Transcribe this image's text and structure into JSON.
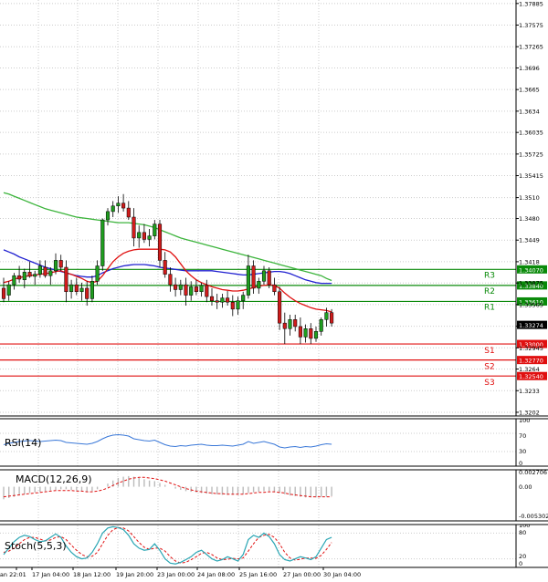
{
  "chart_data": {
    "type": "candlestick",
    "instrument_note": "",
    "price_axis": {
      "ticks": [
        1.37885,
        1.37575,
        1.37265,
        1.3696,
        1.3665,
        1.3634,
        1.36035,
        1.35725,
        1.35415,
        1.351,
        1.348,
        1.3449,
        1.3418,
        1.33875,
        1.33565,
        1.33255,
        1.32945,
        1.3264,
        1.3233,
        1.3202
      ],
      "range": [
        1.3198,
        1.37935
      ]
    },
    "time_axis": {
      "labels": [
        "Jan 22:01",
        "17 Jan 04:00",
        "18 Jan 12:00",
        "19 Jan 20:00",
        "23 Jan 00:00",
        "24 Jan 08:00",
        "25 Jan 16:00",
        "27 Jan 00:00",
        "30 Jan 04:00"
      ]
    },
    "current_price": "1.33274",
    "levels": [
      {
        "name": "R3",
        "value": 1.3407,
        "label": "1.34070",
        "color": "#0a8a0a"
      },
      {
        "name": "R2",
        "value": 1.3384,
        "label": "1.33840",
        "color": "#0a8a0a"
      },
      {
        "name": "R1",
        "value": 1.3361,
        "label": "1.33610",
        "color": "#0a8a0a"
      },
      {
        "name": "S1",
        "value": 1.33,
        "label": "1.33000",
        "color": "#e01010"
      },
      {
        "name": "S2",
        "value": 1.3277,
        "label": "1.32770",
        "color": "#e01010"
      },
      {
        "name": "S3",
        "value": 1.3254,
        "label": "1.32540",
        "color": "#e01010"
      }
    ],
    "candles": [
      [
        1.338,
        1.3395,
        1.336,
        1.3365
      ],
      [
        1.337,
        1.339,
        1.3362,
        1.3385
      ],
      [
        1.3385,
        1.3402,
        1.3378,
        1.3398
      ],
      [
        1.3398,
        1.3412,
        1.3388,
        1.3393
      ],
      [
        1.3392,
        1.3408,
        1.338,
        1.3403
      ],
      [
        1.3403,
        1.3418,
        1.3395,
        1.3397
      ],
      [
        1.3397,
        1.3405,
        1.3385,
        1.34
      ],
      [
        1.34,
        1.342,
        1.3395,
        1.3412
      ],
      [
        1.341,
        1.342,
        1.3395,
        1.3398
      ],
      [
        1.3398,
        1.341,
        1.3385,
        1.3405
      ],
      [
        1.3405,
        1.343,
        1.34,
        1.342
      ],
      [
        1.342,
        1.3428,
        1.3405,
        1.341
      ],
      [
        1.341,
        1.342,
        1.336,
        1.3375
      ],
      [
        1.3375,
        1.3392,
        1.3365,
        1.3385
      ],
      [
        1.3385,
        1.3395,
        1.337,
        1.3375
      ],
      [
        1.3375,
        1.3388,
        1.3362,
        1.338
      ],
      [
        1.338,
        1.339,
        1.3355,
        1.3365
      ],
      [
        1.3365,
        1.3398,
        1.336,
        1.339
      ],
      [
        1.339,
        1.342,
        1.3385,
        1.3412
      ],
      [
        1.3412,
        1.348,
        1.3405,
        1.3478
      ],
      [
        1.3478,
        1.3495,
        1.347,
        1.349
      ],
      [
        1.349,
        1.3505,
        1.3482,
        1.3498
      ],
      [
        1.3498,
        1.3512,
        1.3488,
        1.3502
      ],
      [
        1.3502,
        1.3515,
        1.349,
        1.3495
      ],
      [
        1.3495,
        1.3505,
        1.3478,
        1.3482
      ],
      [
        1.3482,
        1.3495,
        1.344,
        1.3452
      ],
      [
        1.3452,
        1.347,
        1.3438,
        1.346
      ],
      [
        1.346,
        1.3472,
        1.3445,
        1.345
      ],
      [
        1.345,
        1.3465,
        1.344,
        1.3455
      ],
      [
        1.3455,
        1.3478,
        1.345,
        1.3472
      ],
      [
        1.3472,
        1.3478,
        1.341,
        1.342
      ],
      [
        1.342,
        1.3432,
        1.3395,
        1.34
      ],
      [
        1.34,
        1.341,
        1.3375,
        1.3385
      ],
      [
        1.3385,
        1.3395,
        1.3368,
        1.3378
      ],
      [
        1.3378,
        1.3392,
        1.337,
        1.3385
      ],
      [
        1.3385,
        1.3395,
        1.3355,
        1.337
      ],
      [
        1.337,
        1.339,
        1.3362,
        1.3382
      ],
      [
        1.3382,
        1.3392,
        1.337,
        1.3375
      ],
      [
        1.3375,
        1.3388,
        1.3368,
        1.3384
      ],
      [
        1.3384,
        1.3392,
        1.336,
        1.3368
      ],
      [
        1.3368,
        1.338,
        1.3355,
        1.3362
      ],
      [
        1.3362,
        1.3372,
        1.335,
        1.336
      ],
      [
        1.336,
        1.3372,
        1.3352,
        1.3366
      ],
      [
        1.3366,
        1.3376,
        1.3355,
        1.336
      ],
      [
        1.336,
        1.337,
        1.334,
        1.335
      ],
      [
        1.335,
        1.3368,
        1.3342,
        1.3362
      ],
      [
        1.3362,
        1.3375,
        1.335,
        1.337
      ],
      [
        1.337,
        1.3428,
        1.3365,
        1.3412
      ],
      [
        1.3412,
        1.342,
        1.3372,
        1.338
      ],
      [
        1.338,
        1.3395,
        1.3372,
        1.339
      ],
      [
        1.339,
        1.3412,
        1.3385,
        1.3405
      ],
      [
        1.3405,
        1.341,
        1.338,
        1.3385
      ],
      [
        1.3385,
        1.3395,
        1.337,
        1.3375
      ],
      [
        1.3375,
        1.3382,
        1.332,
        1.333
      ],
      [
        1.333,
        1.3345,
        1.33,
        1.3322
      ],
      [
        1.3322,
        1.3342,
        1.3312,
        1.3335
      ],
      [
        1.3335,
        1.3342,
        1.3318,
        1.3325
      ],
      [
        1.3325,
        1.3338,
        1.33,
        1.331
      ],
      [
        1.331,
        1.3328,
        1.3302,
        1.3322
      ],
      [
        1.3322,
        1.333,
        1.33,
        1.3308
      ],
      [
        1.3308,
        1.3325,
        1.3303,
        1.3318
      ],
      [
        1.3318,
        1.3338,
        1.3312,
        1.3335
      ],
      [
        1.3335,
        1.3352,
        1.3325,
        1.3345
      ],
      [
        1.3345,
        1.335,
        1.3325,
        1.333
      ]
    ],
    "ma_fast": [
      1.3388,
      1.339,
      1.3393,
      1.3395,
      1.3397,
      1.3398,
      1.3399,
      1.34,
      1.3401,
      1.3402,
      1.3404,
      1.3405,
      1.3402,
      1.34,
      1.3397,
      1.3394,
      1.339,
      1.3388,
      1.339,
      1.3398,
      1.3408,
      1.3418,
      1.3425,
      1.343,
      1.3433,
      1.3435,
      1.3436,
      1.3436,
      1.3436,
      1.3436,
      1.3436,
      1.3435,
      1.3432,
      1.3425,
      1.3415,
      1.3405,
      1.3398,
      1.3392,
      1.3388,
      1.3385,
      1.3382,
      1.338,
      1.3378,
      1.3377,
      1.3376,
      1.3376,
      1.3377,
      1.3379,
      1.3381,
      1.3383,
      1.3384,
      1.3385,
      1.3384,
      1.338,
      1.3373,
      1.3367,
      1.3362,
      1.3358,
      1.3355,
      1.3352,
      1.335,
      1.3349,
      1.3348,
      1.3346
    ],
    "ma_mid": [
      1.3435,
      1.3432,
      1.3429,
      1.3425,
      1.3422,
      1.3419,
      1.3416,
      1.3413,
      1.341,
      1.3408,
      1.3406,
      1.3404,
      1.3402,
      1.34,
      1.3398,
      1.3397,
      1.3396,
      1.3396,
      1.3398,
      1.3402,
      1.3405,
      1.3408,
      1.341,
      1.3412,
      1.3413,
      1.3414,
      1.3414,
      1.3414,
      1.3413,
      1.3412,
      1.341,
      1.3409,
      1.3408,
      1.3407,
      1.3406,
      1.3405,
      1.3405,
      1.3405,
      1.3405,
      1.3405,
      1.3405,
      1.3404,
      1.3403,
      1.3402,
      1.3401,
      1.34,
      1.3399,
      1.3399,
      1.34,
      1.3401,
      1.3402,
      1.3403,
      1.3404,
      1.3404,
      1.3403,
      1.3401,
      1.3398,
      1.3395,
      1.3392,
      1.339,
      1.3388,
      1.3387,
      1.3387,
      1.3387
    ],
    "ma_slow": [
      1.3517,
      1.3515,
      1.3512,
      1.3509,
      1.3506,
      1.3503,
      1.35,
      1.3497,
      1.3494,
      1.3492,
      1.349,
      1.3488,
      1.3486,
      1.3484,
      1.3482,
      1.3481,
      1.348,
      1.3479,
      1.3478,
      1.3477,
      1.3476,
      1.3475,
      1.3474,
      1.3474,
      1.3474,
      1.3473,
      1.3472,
      1.3471,
      1.3469,
      1.3467,
      1.3464,
      1.3461,
      1.3458,
      1.3455,
      1.3452,
      1.345,
      1.3448,
      1.3446,
      1.3444,
      1.3442,
      1.344,
      1.3438,
      1.3436,
      1.3434,
      1.3432,
      1.343,
      1.3428,
      1.3426,
      1.3424,
      1.3422,
      1.342,
      1.3418,
      1.3416,
      1.3414,
      1.3412,
      1.341,
      1.3408,
      1.3406,
      1.3404,
      1.3402,
      1.34,
      1.3398,
      1.3394,
      1.3391
    ],
    "rsi": {
      "label": "RSI(14)",
      "ticks": [
        "100",
        "70",
        "30",
        "0"
      ],
      "range": [
        0,
        100
      ],
      "values": [
        45,
        48,
        50,
        52,
        53,
        54,
        53,
        52,
        53,
        54,
        55,
        54,
        50,
        49,
        48,
        47,
        46,
        48,
        52,
        58,
        63,
        66,
        67,
        66,
        64,
        58,
        56,
        54,
        53,
        55,
        50,
        45,
        42,
        41,
        43,
        42,
        44,
        45,
        46,
        44,
        43,
        43,
        44,
        43,
        42,
        44,
        46,
        52,
        48,
        50,
        52,
        49,
        46,
        40,
        38,
        40,
        41,
        39,
        41,
        40,
        42,
        45,
        47,
        46
      ]
    },
    "macd": {
      "label": "MACD(12,26,9)",
      "ticks": [
        "0.002706",
        "0.00",
        "-0.005302"
      ],
      "range": [
        -0.005302,
        0.002706
      ],
      "histogram": [
        -0.002,
        -0.0018,
        -0.0016,
        -0.0014,
        -0.0012,
        -0.001,
        -0.0009,
        -0.0008,
        -0.0007,
        -0.0006,
        -0.0005,
        -0.0004,
        -0.0004,
        -0.0005,
        -0.0006,
        -0.0007,
        -0.0008,
        -0.0007,
        -0.0004,
        0.0,
        0.0005,
        0.001,
        0.0014,
        0.0016,
        0.0017,
        0.0016,
        0.0014,
        0.0012,
        0.001,
        0.0009,
        0.0006,
        0.0003,
        0.0,
        -0.0003,
        -0.0005,
        -0.0007,
        -0.0008,
        -0.0009,
        -0.001,
        -0.0011,
        -0.0012,
        -0.0012,
        -0.0013,
        -0.0013,
        -0.0013,
        -0.0013,
        -0.0012,
        -0.001,
        -0.0009,
        -0.0008,
        -0.0007,
        -0.0007,
        -0.0008,
        -0.001,
        -0.0012,
        -0.0014,
        -0.0015,
        -0.0016,
        -0.0017,
        -0.0017,
        -0.0017,
        -0.0016,
        -0.0016,
        -0.0015
      ],
      "signal": [
        -0.0016,
        -0.0015,
        -0.0014,
        -0.0013,
        -0.0012,
        -0.0011,
        -0.001,
        -0.0009,
        -0.0008,
        -0.0007,
        -0.0006,
        -0.0006,
        -0.0006,
        -0.0006,
        -0.0007,
        -0.0007,
        -0.0008,
        -0.0008,
        -0.0007,
        -0.0005,
        -0.0002,
        0.0002,
        0.0006,
        0.0009,
        0.0012,
        0.0014,
        0.0015,
        0.0015,
        0.0014,
        0.0013,
        0.0011,
        0.0009,
        0.0006,
        0.0003,
        0.0,
        -0.0003,
        -0.0005,
        -0.0007,
        -0.0008,
        -0.0009,
        -0.001,
        -0.0011,
        -0.0011,
        -0.0012,
        -0.0012,
        -0.0012,
        -0.0012,
        -0.0011,
        -0.001,
        -0.0009,
        -0.0009,
        -0.0008,
        -0.0008,
        -0.0009,
        -0.001,
        -0.0012,
        -0.0013,
        -0.0014,
        -0.0015,
        -0.0016,
        -0.0016,
        -0.0016,
        -0.0016,
        -0.0016
      ]
    },
    "stoch": {
      "label": "Stoch(5,5,3)",
      "ticks": [
        "100",
        "80",
        "20",
        "0"
      ],
      "range": [
        0,
        100
      ],
      "k": [
        30,
        45,
        60,
        70,
        75,
        72,
        65,
        60,
        62,
        70,
        78,
        70,
        50,
        35,
        25,
        20,
        22,
        35,
        55,
        80,
        92,
        95,
        93,
        88,
        75,
        55,
        45,
        40,
        42,
        55,
        40,
        20,
        10,
        8,
        12,
        18,
        25,
        35,
        40,
        30,
        20,
        15,
        18,
        25,
        20,
        15,
        30,
        65,
        75,
        70,
        80,
        72,
        55,
        30,
        18,
        15,
        20,
        25,
        22,
        18,
        25,
        45,
        65,
        70
      ],
      "d": [
        35,
        38,
        45,
        55,
        65,
        70,
        70,
        66,
        62,
        64,
        70,
        72,
        65,
        52,
        40,
        30,
        25,
        26,
        35,
        55,
        75,
        88,
        93,
        92,
        85,
        72,
        58,
        47,
        42,
        45,
        45,
        38,
        25,
        15,
        10,
        12,
        18,
        25,
        33,
        35,
        30,
        22,
        18,
        19,
        21,
        20,
        22,
        38,
        55,
        70,
        75,
        77,
        70,
        55,
        35,
        22,
        17,
        19,
        22,
        22,
        21,
        28,
        42,
        58
      ]
    },
    "colors": {
      "bull_candle": "#1f9e1f",
      "bear_candle": "#d01c1c",
      "ma_fast": "#e01010",
      "ma_mid": "#2020d0",
      "ma_slow": "#3cb43c",
      "rsi_line": "#3a78d8",
      "macd_hist": "#bbbbbb",
      "macd_signal": "#e01010",
      "stoch_k": "#2aa6b4",
      "stoch_d": "#e01010",
      "current_price_box": "#000000",
      "grid": "#cccccc"
    }
  }
}
